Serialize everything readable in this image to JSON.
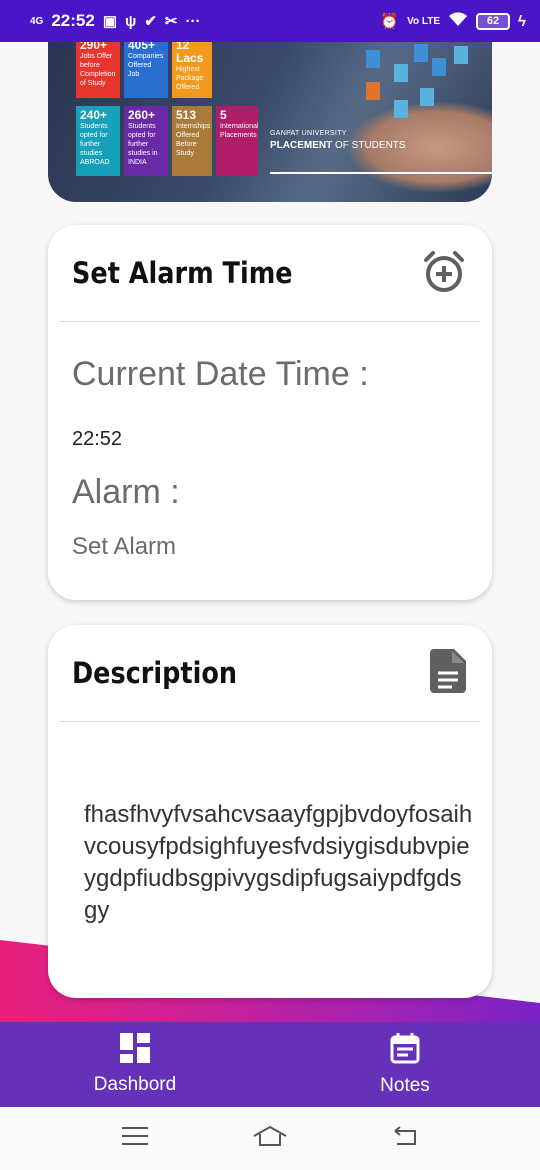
{
  "status_bar": {
    "network": "4G",
    "time": "22:52",
    "volte": "Vo LTE",
    "battery": "62"
  },
  "banner": {
    "tiles": [
      {
        "big": "290+",
        "small": "Jobs Offer before Completion of Study",
        "color": "#e8352e"
      },
      {
        "big": "405+",
        "small": "Companies Offered Job",
        "color": "#2a6fd0"
      },
      {
        "big": "12 Lacs",
        "small": "Highest Package Offered",
        "color": "#f39a1c"
      },
      {
        "big": "240+",
        "small": "Students opted for further studies ABROAD",
        "color": "#17a0b8"
      },
      {
        "big": "260+",
        "small": "Students opted for further studies in INDIA",
        "color": "#6a2aa8"
      },
      {
        "big": "513",
        "small": "Internships Offered Before Study",
        "color": "#a97a3a"
      },
      {
        "big": "5",
        "small": "International Placements",
        "color": "#b01e6a"
      }
    ],
    "university": "GANPAT UNIVERSITY",
    "placement_bold": "PLACEMENT",
    "placement_rest": " OF STUDENTS"
  },
  "alarm_card": {
    "title": "Set Alarm Time",
    "icon": "alarm-add-icon",
    "current_label": "Current Date Time :",
    "current_value": "22:52",
    "alarm_label": "Alarm :",
    "alarm_value": "Set Alarm"
  },
  "description_card": {
    "title": "Description",
    "icon": "document-icon",
    "text": "fhasfhvyfvsahcvsaayfgpjbvdoyfosaihvcousyfpdsighfuyesfvdsiygisdubvpieygdpfiudbsgpivygsdipfugsaiypdfgdsgy"
  },
  "bottom_nav": {
    "items": [
      {
        "label": "Dashbord",
        "icon": "dashboard-icon"
      },
      {
        "label": "Notes",
        "icon": "calendar-notes-icon"
      }
    ]
  },
  "colors": {
    "status_bar": "#4a14c7",
    "bottom_nav": "#6431b8",
    "icon_grey": "#5f5f5f"
  }
}
